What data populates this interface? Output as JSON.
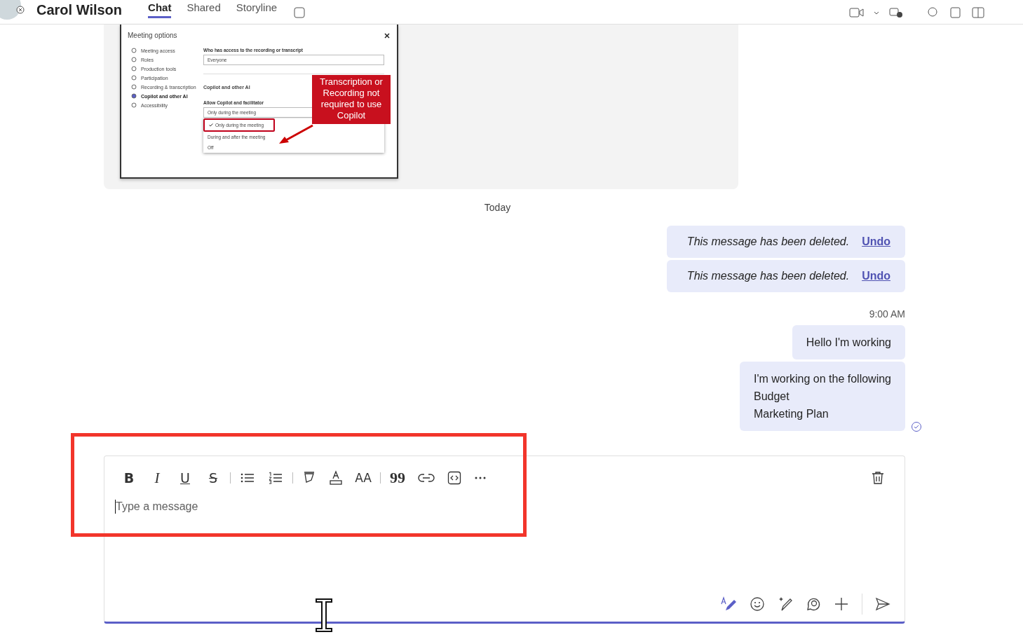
{
  "header": {
    "name": "Carol Wilson",
    "tabs": [
      {
        "label": "Chat",
        "selected": true
      },
      {
        "label": "Shared",
        "selected": false
      },
      {
        "label": "Storyline",
        "selected": false
      }
    ]
  },
  "shared_image": {
    "title": "Meeting options",
    "nav": [
      {
        "label": "Meeting access",
        "selected": false
      },
      {
        "label": "Roles",
        "selected": false
      },
      {
        "label": "Production tools",
        "selected": false
      },
      {
        "label": "Participation",
        "selected": false
      },
      {
        "label": "Recording & transcription",
        "selected": false
      },
      {
        "label": "Copilot and other AI",
        "selected": true
      },
      {
        "label": "Accessibility",
        "selected": false
      }
    ],
    "access_label": "Who has access to the recording or transcript",
    "access_value": "Everyone",
    "section": "Copilot and other AI",
    "allow_label": "Allow Copilot and facilitator",
    "allow_value": "Only during the meeting",
    "options": [
      {
        "label": "Only during the meeting",
        "selected": true
      },
      {
        "label": "During and after the meeting",
        "selected": false
      },
      {
        "label": "Off",
        "selected": false
      }
    ],
    "callout": "Transcription or Recording not required to use Copilot"
  },
  "date_divider": "Today",
  "messages": [
    {
      "kind": "deleted",
      "text": "This message has been deleted.",
      "action": "Undo"
    },
    {
      "kind": "deleted",
      "text": "This message has been deleted.",
      "action": "Undo"
    },
    {
      "kind": "time",
      "text": "9:00 AM"
    },
    {
      "kind": "text",
      "lines": [
        "Hello I'm working"
      ]
    },
    {
      "kind": "text",
      "lines": [
        "I'm working on the following",
        "Budget",
        "Marketing Plan"
      ],
      "seen": true
    }
  ],
  "composer": {
    "toolbar": [
      {
        "kind": "bold",
        "glyph": "B"
      },
      {
        "kind": "italic",
        "glyph": "I"
      },
      {
        "kind": "underline",
        "glyph": "U"
      },
      {
        "kind": "strike",
        "glyph": "S"
      },
      {
        "kind": "divider"
      },
      {
        "kind": "bullets"
      },
      {
        "kind": "numbered"
      },
      {
        "kind": "divider"
      },
      {
        "kind": "highlight"
      },
      {
        "kind": "fontcolor"
      },
      {
        "kind": "size",
        "glyph": "AA"
      },
      {
        "kind": "divider"
      },
      {
        "kind": "quote",
        "glyph": "99"
      },
      {
        "kind": "link"
      },
      {
        "kind": "code"
      },
      {
        "kind": "more"
      }
    ],
    "placeholder": "Type a message",
    "actions": [
      {
        "kind": "format"
      },
      {
        "kind": "emoji"
      },
      {
        "kind": "copilot"
      },
      {
        "kind": "loop"
      },
      {
        "kind": "plus"
      },
      {
        "kind": "divider"
      },
      {
        "kind": "send"
      }
    ]
  }
}
